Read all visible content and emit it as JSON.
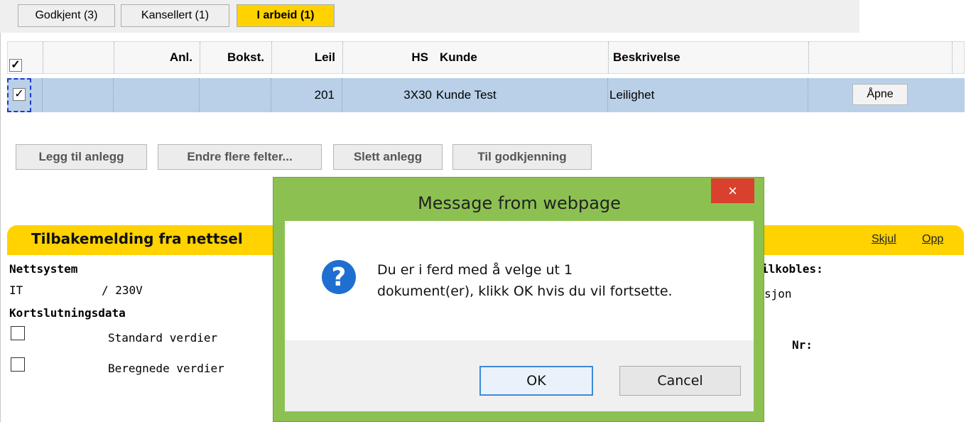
{
  "tabs": [
    {
      "label": "Godkjent (3)",
      "active": false
    },
    {
      "label": "Kansellert (1)",
      "active": false
    },
    {
      "label": "I arbeid (1)",
      "active": true
    }
  ],
  "grid": {
    "headers": {
      "check": "✓",
      "anl": "Anl.",
      "bokst": "Bokst.",
      "leil": "Leil",
      "hs": "HS",
      "kunde": "Kunde",
      "beskrivelse": "Beskrivelse"
    },
    "row": {
      "checked": "✓",
      "anl": "",
      "bokst": "",
      "leil": "201",
      "hs": "3X30",
      "kunde": "Kunde Test",
      "beskrivelse": "Leilighet",
      "open_label": "Åpne"
    }
  },
  "actions": {
    "add": "Legg til anlegg",
    "edit_more": "Endre flere felter...",
    "delete": "Slett anlegg",
    "to_approval": "Til godkjenning"
  },
  "panel": {
    "title": "Tilbakemelding fra nettsel",
    "hide_link": "Skjul",
    "up_link": "Opp",
    "nettsystem_label": "Nettsystem",
    "nett_type": "IT",
    "voltage": "/ 230V",
    "kortslutning_label": "Kortslutningsdata",
    "standard_label": "Standard verdier",
    "beregnede_label": "Beregnede verdier",
    "tilkobles_fragment": "ilkobles:",
    "sjon_fragment": "sjon",
    "nr_label": "Nr:"
  },
  "dialog": {
    "title": "Message from webpage",
    "close_icon": "×",
    "line1": "Du er i ferd med å velge ut 1",
    "line2": "dokument(er), klikk OK hvis du vil fortsette.",
    "ok": "OK",
    "cancel": "Cancel",
    "icon": "question-icon",
    "icon_glyph": "?"
  },
  "colors": {
    "accent_yellow": "#ffd200",
    "selected_row": "#b9d0e8",
    "dialog_frame": "#8cc152",
    "close_red": "#d9412e",
    "question_blue": "#1f6fd1"
  }
}
